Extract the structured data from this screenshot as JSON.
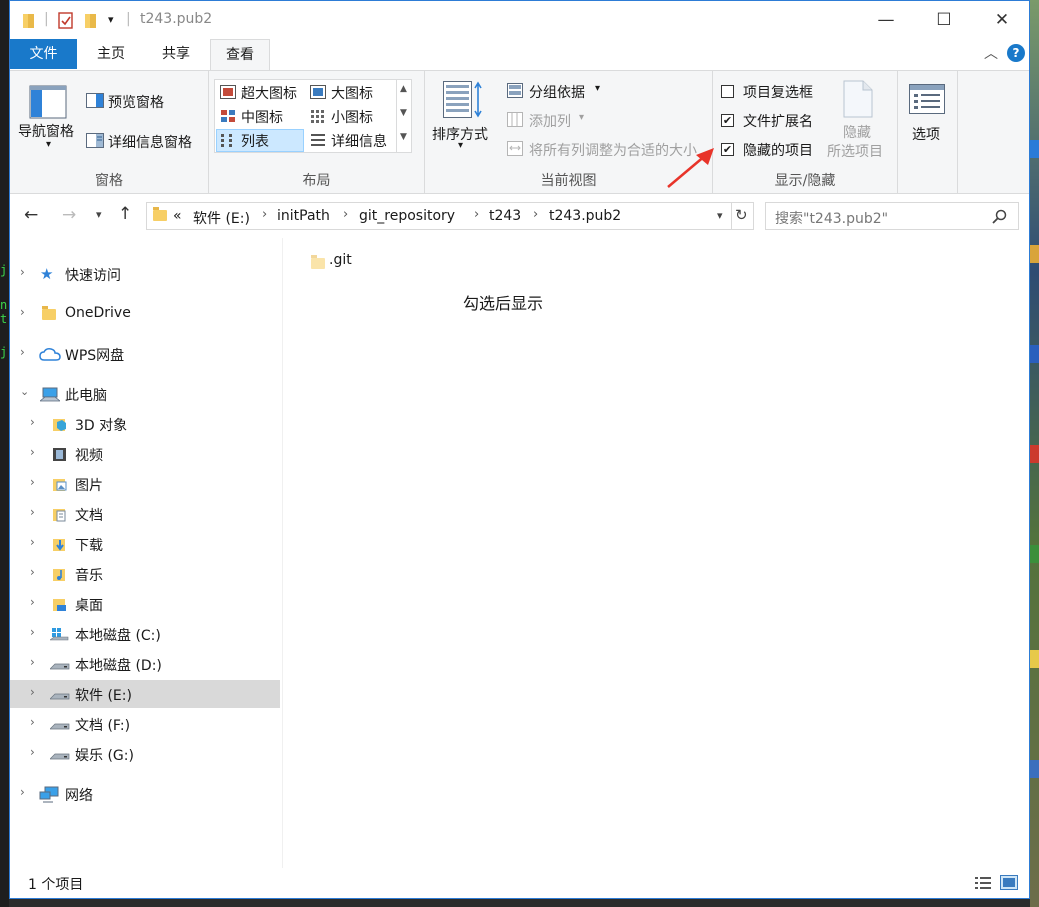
{
  "window": {
    "title": "t243.pub2",
    "controls": {
      "minimize": "—",
      "maximize": "☐",
      "close": "✕"
    },
    "help": "?"
  },
  "tabs": {
    "file": "文件",
    "home": "主页",
    "share": "共享",
    "view": "查看"
  },
  "ribbon": {
    "panes": {
      "label": "窗格",
      "nav_pane": "导航窗格",
      "preview_pane": "预览窗格",
      "details_pane": "详细信息窗格"
    },
    "layout": {
      "label": "布局",
      "items": [
        "超大图标",
        "大图标",
        "中图标",
        "小图标",
        "列表",
        "详细信息"
      ],
      "selected": "列表"
    },
    "current_view": {
      "label": "当前视图",
      "sort_by": "排序方式",
      "group_by": "分组依据",
      "add_column": "添加列",
      "size_columns": "将所有列调整为合适的大小"
    },
    "show_hide": {
      "label": "显示/隐藏",
      "item_checkboxes": {
        "label": "项目复选框",
        "checked": false
      },
      "file_extensions": {
        "label": "文件扩展名",
        "checked": true
      },
      "hidden_items": {
        "label": "隐藏的项目",
        "checked": true
      },
      "hide_selected_line1": "隐藏",
      "hide_selected_line2": "所选项目",
      "check_mark": "✔"
    },
    "options": {
      "label": "选项"
    }
  },
  "address": {
    "overflow": "«",
    "path": [
      "软件 (E:)",
      "initPath",
      "git_repository",
      "t243",
      "t243.pub2"
    ],
    "search_placeholder": "搜索\"t243.pub2\""
  },
  "nav": {
    "items": [
      {
        "label": "快速访问"
      },
      {
        "label": "OneDrive"
      },
      {
        "label": "WPS网盘"
      },
      {
        "label": "此电脑"
      },
      {
        "label": "3D 对象"
      },
      {
        "label": "视频"
      },
      {
        "label": "图片"
      },
      {
        "label": "文档"
      },
      {
        "label": "下载"
      },
      {
        "label": "音乐"
      },
      {
        "label": "桌面"
      },
      {
        "label": "本地磁盘 (C:)"
      },
      {
        "label": "本地磁盘 (D:)"
      },
      {
        "label": "软件 (E:)"
      },
      {
        "label": "文档 (F:)"
      },
      {
        "label": "娱乐 (G:)"
      },
      {
        "label": "网络"
      }
    ]
  },
  "content": {
    "files": [
      ".git"
    ],
    "annotation": "勾选后显示"
  },
  "status": {
    "count": "1 个项目"
  },
  "colors": {
    "accent": "#1979ca",
    "arrow": "#e8342a",
    "selection": "#d9d9d9",
    "layout_selected": "#cce8ff"
  },
  "icons": [
    "folder-icon",
    "checklist-icon",
    "dropdown-icon",
    "back-arrow-icon",
    "forward-arrow-icon",
    "up-arrow-icon",
    "refresh-icon",
    "search-icon",
    "star-icon",
    "cloud-icon",
    "computer-icon",
    "network-icon",
    "drive-icon",
    "details-view-icon",
    "large-icons-view-icon"
  ]
}
